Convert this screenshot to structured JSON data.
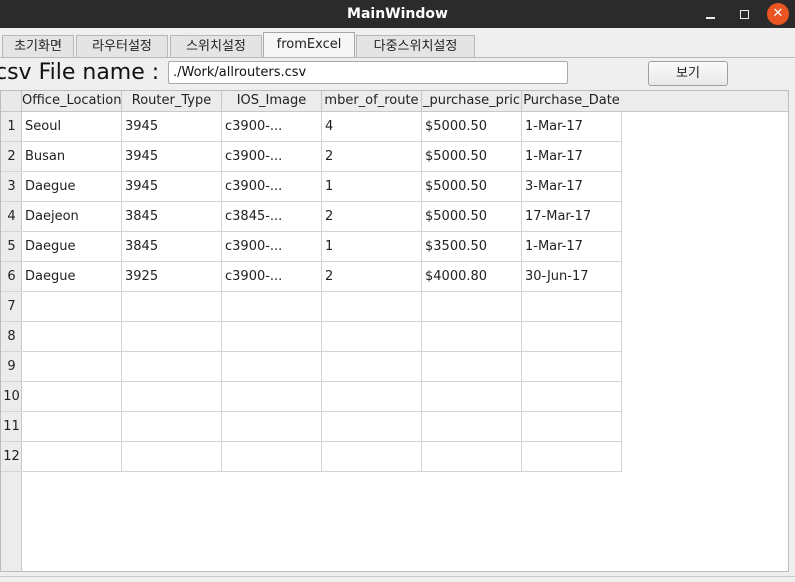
{
  "window": {
    "title": "MainWindow",
    "minimize_glyph": "",
    "maximize_glyph": "",
    "close_glyph": "✕"
  },
  "tabs": [
    {
      "label": "초기화면"
    },
    {
      "label": "라우터설정"
    },
    {
      "label": "스위치설정"
    },
    {
      "label": "fromExcel"
    },
    {
      "label": "다중스위치설정"
    }
  ],
  "active_tab": "fromExcel",
  "file": {
    "label": "csv File name :",
    "value": "./Work/allrouters.csv",
    "view_button": "보기"
  },
  "table": {
    "headers": [
      "Office_Location",
      "Router_Type",
      "IOS_Image",
      "Number_of_routers",
      "Purchase_price",
      "Purchase_Date"
    ],
    "header_display": [
      "Office_Location",
      "Router_Type",
      "IOS_Image",
      "mber_of_route",
      "_purchase_pric",
      "Purchase_Date"
    ],
    "row_numbers": [
      "1",
      "2",
      "3",
      "4",
      "5",
      "6",
      "7",
      "8",
      "9",
      "10",
      "11",
      "12"
    ],
    "rows": [
      [
        "Seoul",
        "3945",
        "c3900-...",
        "4",
        "$5000.50",
        "1-Mar-17"
      ],
      [
        "Busan",
        "3945",
        "c3900-...",
        "2",
        "$5000.50",
        "1-Mar-17"
      ],
      [
        "Daegue",
        "3945",
        "c3900-...",
        "1",
        "$5000.50",
        "3-Mar-17"
      ],
      [
        "Daejeon",
        "3845",
        "c3845-...",
        "2",
        "$5000.50",
        "17-Mar-17"
      ],
      [
        "Daegue",
        "3845",
        "c3900-...",
        "1",
        "$3500.50",
        "1-Mar-17"
      ],
      [
        "Daegue",
        "3925",
        "c3900-...",
        "2",
        "$4000.80",
        "30-Jun-17"
      ],
      [
        "",
        "",
        "",
        "",
        "",
        ""
      ],
      [
        "",
        "",
        "",
        "",
        "",
        ""
      ],
      [
        "",
        "",
        "",
        "",
        "",
        ""
      ],
      [
        "",
        "",
        "",
        "",
        "",
        ""
      ],
      [
        "",
        "",
        "",
        "",
        "",
        ""
      ],
      [
        "",
        "",
        "",
        "",
        "",
        ""
      ]
    ]
  },
  "colors": {
    "titlebar": "#2b2b2b",
    "close_button": "#e95420",
    "window_bg": "#efefef"
  }
}
